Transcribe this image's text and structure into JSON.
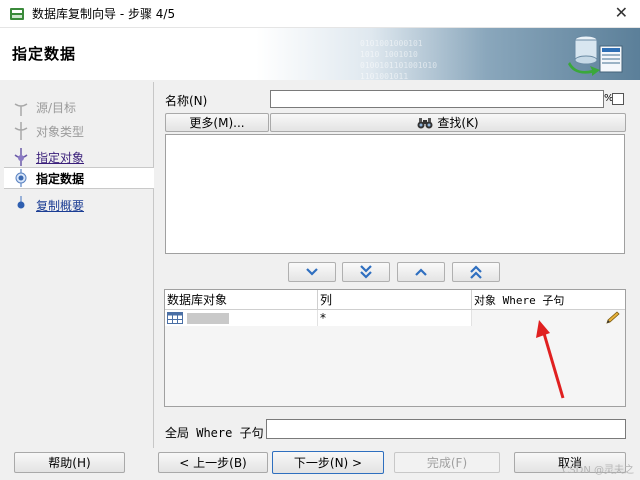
{
  "window": {
    "title": "数据库复制向导 - 步骤 4/5"
  },
  "banner": {
    "page_title": "指定数据",
    "deco_lines": [
      "0101001000101",
      "1010 1001010",
      "0100101101001010",
      "1101001011"
    ]
  },
  "nav": {
    "items": [
      {
        "label": "源/目标",
        "state": "disabled"
      },
      {
        "label": "对象类型",
        "state": "disabled"
      },
      {
        "label": "指定对象",
        "state": "visited"
      },
      {
        "label": "指定数据",
        "state": "current"
      },
      {
        "label": "复制概要",
        "state": "next"
      }
    ]
  },
  "search": {
    "name_label": "名称(N)",
    "name_value": "",
    "percent_symbol": "%",
    "more_button": "更多(M)...",
    "find_button": "查找(K)"
  },
  "grid": {
    "headers": [
      "数据库对象",
      "列",
      "对象 Where 子句"
    ],
    "rows": [
      {
        "object": "",
        "column": "*",
        "where": ""
      }
    ]
  },
  "global_where": {
    "label": "全局 Where 子句:",
    "value": ""
  },
  "footer": {
    "help": "帮助(H)",
    "back": "< 上一步(B)",
    "next": "下一步(N) >",
    "finish": "完成(F)",
    "cancel": "取消"
  },
  "watermark": "CSDN @灵夫之",
  "colors": {
    "annotation_arrow": "#e02020",
    "link": "#1b3d94",
    "visited": "#3a1f7a"
  }
}
